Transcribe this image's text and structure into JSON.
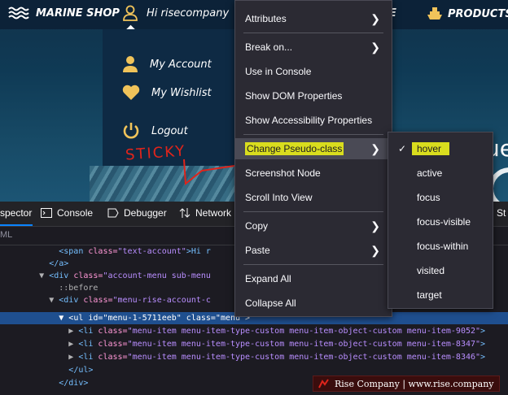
{
  "site": {
    "logo": "MARINE SHOP",
    "greeting": "Hi risecompany",
    "nav_partial": "E",
    "products": "PRODUCTS",
    "menu": [
      {
        "label": "My Account",
        "icon": "user-icon"
      },
      {
        "label": "My Wishlist",
        "icon": "heart-icon"
      },
      {
        "label": "Logout",
        "icon": "power-icon"
      }
    ],
    "annotation": "STICKY",
    "hero_partial": "ue",
    "accent": "#f0c35a"
  },
  "devtools": {
    "tabs": [
      "spector",
      "Console",
      "Debugger",
      "Network",
      "St"
    ],
    "search_partial": "ML",
    "code_lines": [
      {
        "ind": "            ",
        "pre": "",
        "tag": "<span",
        "an": " class=",
        "av": "\"text-account\"",
        "rest": ">Hi r"
      },
      {
        "ind": "          ",
        "pre": "",
        "tag": "</a>",
        "an": "",
        "av": "",
        "rest": ""
      },
      {
        "ind": "        ",
        "pre": "▼ ",
        "tag": "<div",
        "an": " class=",
        "av": "\"account-menu sub-menu",
        "rest": ""
      },
      {
        "ind": "            ",
        "pre": "",
        "tag": "",
        "an": "",
        "av": "",
        "rest": "::before"
      },
      {
        "ind": "          ",
        "pre": "▼ ",
        "tag": "<div",
        "an": " class=",
        "av": "\"menu-rise-account-c",
        "rest": ""
      },
      {
        "ind": "            ",
        "pre": "▼ ",
        "tag": "<ul",
        "an": " id=",
        "av": "\"menu-1-5711eeb\"",
        "rest": " class=\"menu\">"
      },
      {
        "ind": "              ",
        "pre": "▶ ",
        "tag": "<li",
        "an": " class=",
        "av": "\"menu-item menu-item-type-custom menu-item-object-custom menu-item-9052\"",
        "rest": ">"
      },
      {
        "ind": "              ",
        "pre": "▶ ",
        "tag": "<li",
        "an": " class=",
        "av": "\"menu-item menu-item-type-custom menu-item-object-custom menu-item-8347\"",
        "rest": ">"
      },
      {
        "ind": "              ",
        "pre": "▶ ",
        "tag": "<li",
        "an": " class=",
        "av": "\"menu-item menu-item-type-custom menu-item-object-custom menu-item-8346\"",
        "rest": ">"
      },
      {
        "ind": "              ",
        "pre": "",
        "tag": "</ul>",
        "an": "",
        "av": "",
        "rest": ""
      },
      {
        "ind": "            ",
        "pre": "",
        "tag": "</div>",
        "an": "",
        "av": "",
        "rest": ""
      }
    ],
    "selected_line": 5,
    "highlight_color": "#1f4f8f"
  },
  "context_menu": {
    "items": [
      {
        "label": "Attributes",
        "submenu": true,
        "ul": "A"
      },
      {
        "label": "Break on...",
        "submenu": true,
        "ul": ""
      },
      {
        "label": "Use in Console",
        "submenu": false,
        "ul": ""
      },
      {
        "label": "Show DOM Properties",
        "submenu": false,
        "ul": ""
      },
      {
        "label": "Show Accessibility Properties",
        "submenu": false,
        "ul": ""
      },
      {
        "label": "Change Pseudo-class",
        "submenu": true,
        "ul": "",
        "highlighted": true
      },
      {
        "label": "Screenshot Node",
        "submenu": false,
        "ul": ""
      },
      {
        "label": "Scroll Into View",
        "submenu": false,
        "ul": "S"
      },
      {
        "label": "Copy",
        "submenu": true,
        "ul": ""
      },
      {
        "label": "Paste",
        "submenu": true,
        "ul": ""
      },
      {
        "label": "Expand All",
        "submenu": false,
        "ul": ""
      },
      {
        "label": "Collapse All",
        "submenu": false,
        "ul": ""
      }
    ],
    "highlight_mark_color": "#d9dd1e"
  },
  "pseudo_menu": {
    "items": [
      {
        "label": "hover",
        "checked": true
      },
      {
        "label": "active",
        "checked": false
      },
      {
        "label": "focus",
        "checked": false
      },
      {
        "label": "focus-visible",
        "checked": false
      },
      {
        "label": "focus-within",
        "checked": false
      },
      {
        "label": "visited",
        "checked": false
      },
      {
        "label": "target",
        "checked": false
      }
    ],
    "check_glyph": "✓"
  },
  "watermark": {
    "text": "Rise Company | www.rise.company"
  }
}
